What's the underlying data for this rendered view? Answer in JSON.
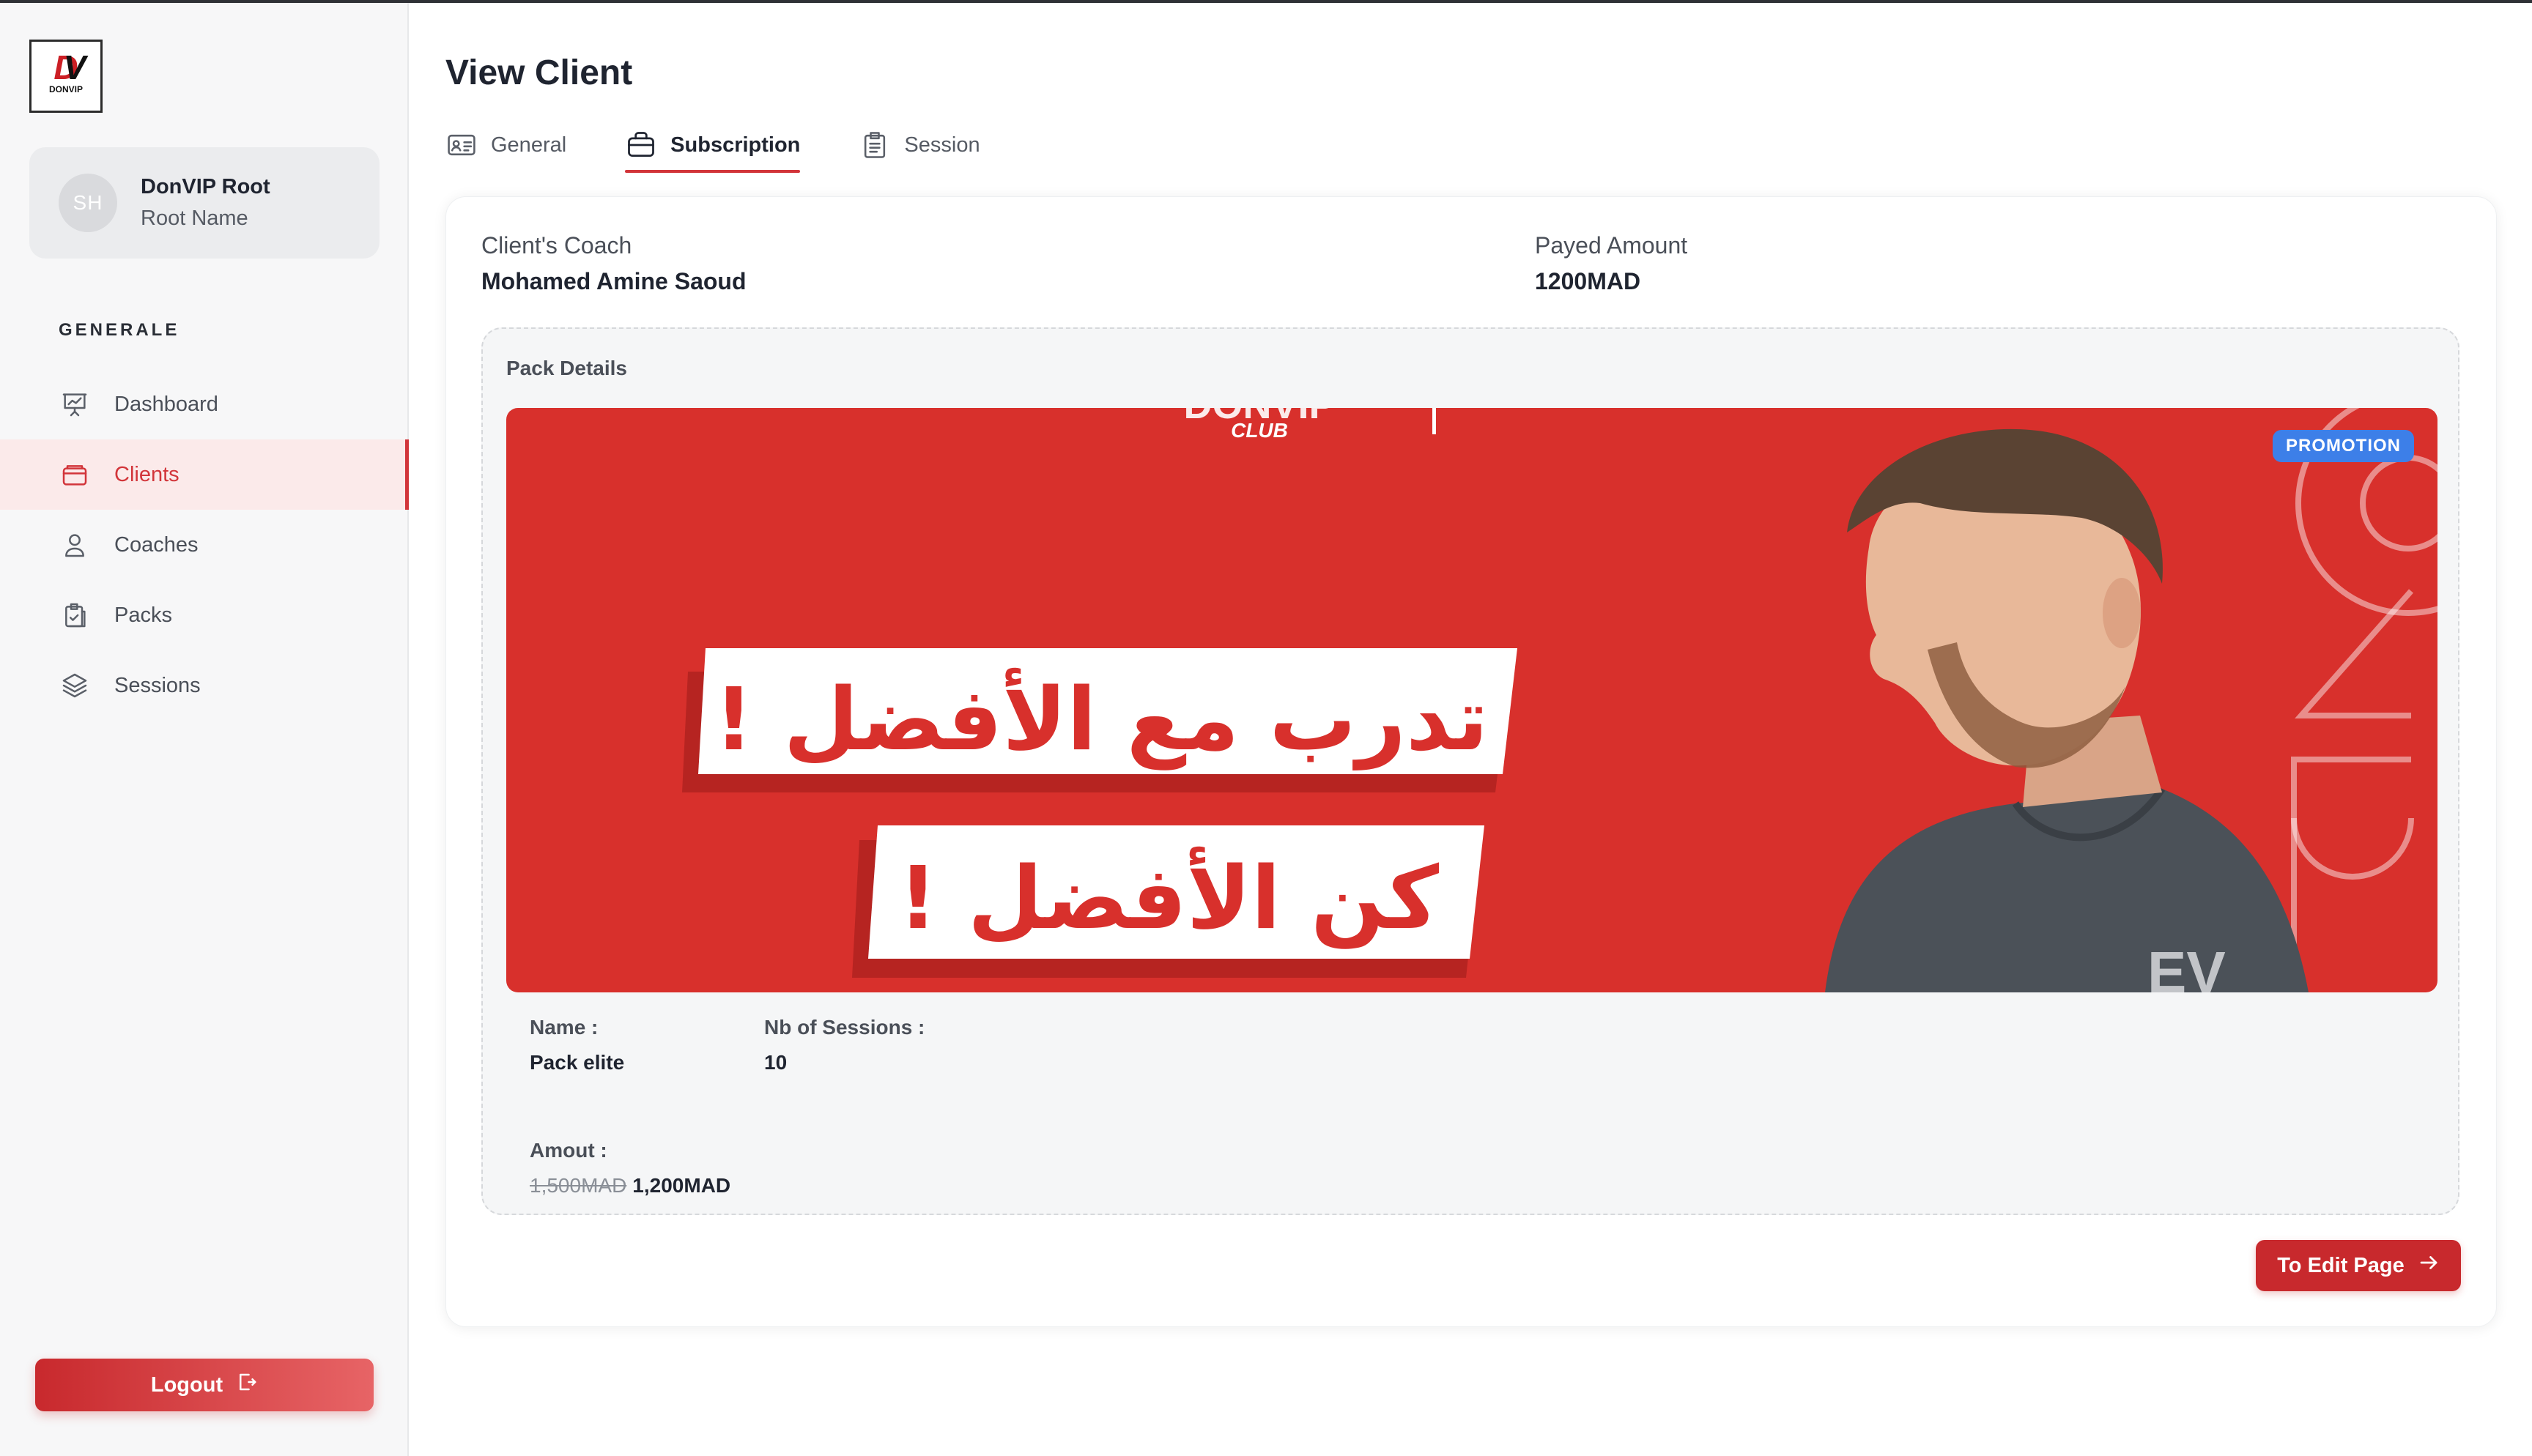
{
  "app": {
    "brand_logo_text": "DV",
    "brand_logo_sub": "DONVIP"
  },
  "user": {
    "initials": "SH",
    "name": "DonVIP Root",
    "role": "Root Name"
  },
  "sidebar": {
    "section_title": "GENERALE",
    "items": [
      {
        "label": "Dashboard",
        "icon": "presentation-chart-icon",
        "active": false
      },
      {
        "label": "Clients",
        "icon": "wallet-icon",
        "active": true
      },
      {
        "label": "Coaches",
        "icon": "user-icon",
        "active": false
      },
      {
        "label": "Packs",
        "icon": "clipboard-check-icon",
        "active": false
      },
      {
        "label": "Sessions",
        "icon": "layers-icon",
        "active": false
      }
    ],
    "logout_label": "Logout"
  },
  "header": {
    "title": "View Client"
  },
  "tabs": [
    {
      "label": "General",
      "icon": "id-card-icon",
      "active": false
    },
    {
      "label": "Subscription",
      "icon": "briefcase-icon",
      "active": true
    },
    {
      "label": "Session",
      "icon": "clipboard-icon",
      "active": false
    }
  ],
  "subscription": {
    "coach_label": "Client's Coach",
    "coach_value": "Mohamed Amine Saoud",
    "amount_label": "Payed Amount",
    "amount_value": "1200MAD",
    "pack": {
      "section_title": "Pack Details",
      "badge": "PROMOTION",
      "banner_line1": "تدرب مع الأفضل !",
      "banner_line2": "كن الأفضل !",
      "banner_club": "CLUB",
      "name_label": "Name :",
      "name_value": "Pack elite",
      "sessions_label": "Nb of Sessions :",
      "sessions_value": "10",
      "amount_label": "Amout :",
      "old_price": "1,500MAD",
      "new_price": "1,200MAD"
    },
    "edit_button": "To Edit Page"
  },
  "colors": {
    "accent": "#d2353a",
    "banner_red": "#d8302c",
    "promo_blue": "#3d7fe8"
  }
}
